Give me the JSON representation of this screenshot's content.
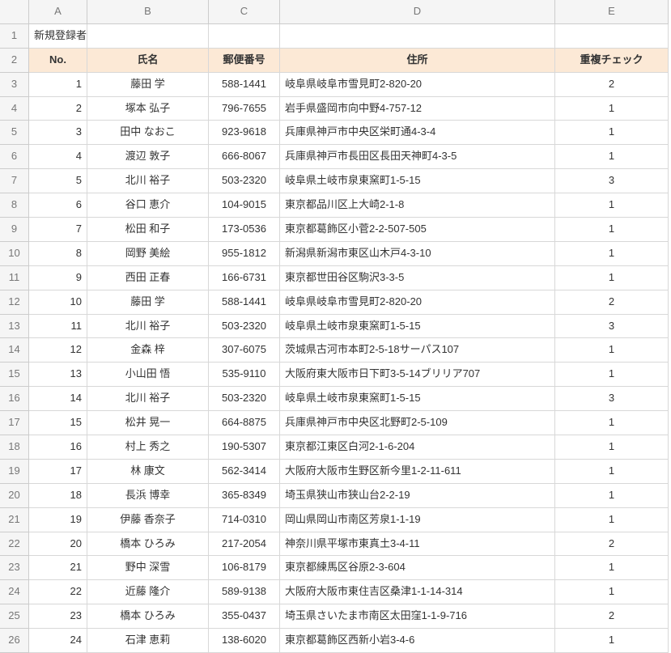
{
  "title": "新規登録者",
  "columns": [
    "A",
    "B",
    "C",
    "D",
    "E"
  ],
  "row_numbers": [
    1,
    2,
    3,
    4,
    5,
    6,
    7,
    8,
    9,
    10,
    11,
    12,
    13,
    14,
    15,
    16,
    17,
    18,
    19,
    20,
    21,
    22,
    23,
    24,
    25,
    26
  ],
  "headers": {
    "no": "No.",
    "name": "氏名",
    "postal": "郵便番号",
    "address": "住所",
    "dup": "重複チェック"
  },
  "rows": [
    {
      "no": 1,
      "name": "藤田 学",
      "postal": "588-1441",
      "address": "岐阜県岐阜市雪見町2-820-20",
      "dup": 2
    },
    {
      "no": 2,
      "name": "塚本 弘子",
      "postal": "796-7655",
      "address": "岩手県盛岡市向中野4-757-12",
      "dup": 1
    },
    {
      "no": 3,
      "name": "田中 なおこ",
      "postal": "923-9618",
      "address": "兵庫県神戸市中央区栄町通4-3-4",
      "dup": 1
    },
    {
      "no": 4,
      "name": "渡辺 敦子",
      "postal": "666-8067",
      "address": "兵庫県神戸市長田区長田天神町4-3-5",
      "dup": 1
    },
    {
      "no": 5,
      "name": "北川 裕子",
      "postal": "503-2320",
      "address": "岐阜県土岐市泉東窯町1-5-15",
      "dup": 3
    },
    {
      "no": 6,
      "name": "谷口 恵介",
      "postal": "104-9015",
      "address": "東京都品川区上大崎2-1-8",
      "dup": 1
    },
    {
      "no": 7,
      "name": "松田 和子",
      "postal": "173-0536",
      "address": "東京都葛飾区小菅2-2-507-505",
      "dup": 1
    },
    {
      "no": 8,
      "name": "岡野 美絵",
      "postal": "955-1812",
      "address": "新潟県新潟市東区山木戸4-3-10",
      "dup": 1
    },
    {
      "no": 9,
      "name": "西田 正春",
      "postal": "166-6731",
      "address": "東京都世田谷区駒沢3-3-5",
      "dup": 1
    },
    {
      "no": 10,
      "name": "藤田 学",
      "postal": "588-1441",
      "address": "岐阜県岐阜市雪見町2-820-20",
      "dup": 2
    },
    {
      "no": 11,
      "name": "北川 裕子",
      "postal": "503-2320",
      "address": "岐阜県土岐市泉東窯町1-5-15",
      "dup": 3
    },
    {
      "no": 12,
      "name": "金森 梓",
      "postal": "307-6075",
      "address": "茨城県古河市本町2-5-18サーパス107",
      "dup": 1
    },
    {
      "no": 13,
      "name": "小山田 悟",
      "postal": "535-9110",
      "address": "大阪府東大阪市日下町3-5-14ブリリア707",
      "dup": 1
    },
    {
      "no": 14,
      "name": "北川 裕子",
      "postal": "503-2320",
      "address": "岐阜県土岐市泉東窯町1-5-15",
      "dup": 3
    },
    {
      "no": 15,
      "name": "松井 晃一",
      "postal": "664-8875",
      "address": "兵庫県神戸市中央区北野町2-5-109",
      "dup": 1
    },
    {
      "no": 16,
      "name": "村上 秀之",
      "postal": "190-5307",
      "address": "東京都江東区白河2-1-6-204",
      "dup": 1
    },
    {
      "no": 17,
      "name": "林 康文",
      "postal": "562-3414",
      "address": "大阪府大阪市生野区新今里1-2-11-611",
      "dup": 1
    },
    {
      "no": 18,
      "name": "長浜 博幸",
      "postal": "365-8349",
      "address": "埼玉県狭山市狭山台2-2-19",
      "dup": 1
    },
    {
      "no": 19,
      "name": "伊藤 香奈子",
      "postal": "714-0310",
      "address": "岡山県岡山市南区芳泉1-1-19",
      "dup": 1
    },
    {
      "no": 20,
      "name": "橋本 ひろみ",
      "postal": "217-2054",
      "address": "神奈川県平塚市東真土3-4-11",
      "dup": 2
    },
    {
      "no": 21,
      "name": "野中 深雪",
      "postal": "106-8179",
      "address": "東京都練馬区谷原2-3-604",
      "dup": 1
    },
    {
      "no": 22,
      "name": "近藤 隆介",
      "postal": "589-9138",
      "address": "大阪府大阪市東住吉区桑津1-1-14-314",
      "dup": 1
    },
    {
      "no": 23,
      "name": "橋本 ひろみ",
      "postal": "355-0437",
      "address": "埼玉県さいたま市南区太田窪1-1-9-716",
      "dup": 2
    },
    {
      "no": 24,
      "name": "石津 恵莉",
      "postal": "138-6020",
      "address": "東京都葛飾区西新小岩3-4-6",
      "dup": 1
    }
  ]
}
